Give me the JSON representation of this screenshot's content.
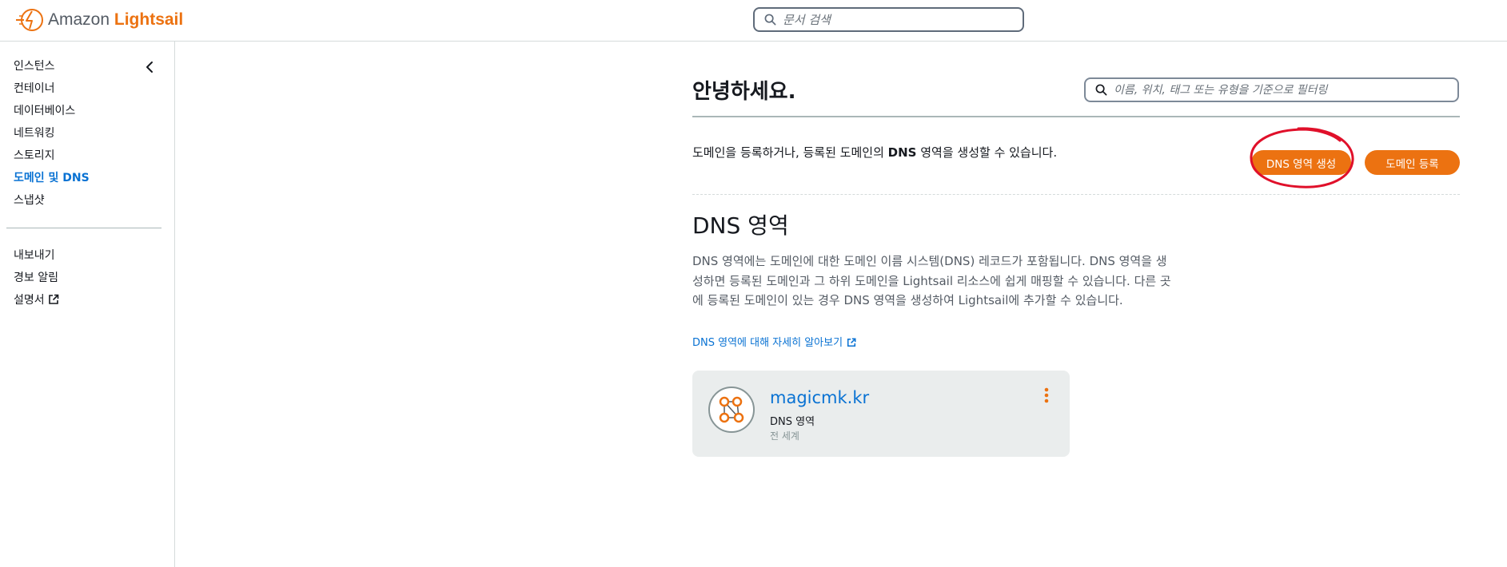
{
  "app": {
    "brand_prefix": "Amazon",
    "brand_name": "Lightsail"
  },
  "header": {
    "search_placeholder": "문서 검색"
  },
  "sidebar": {
    "items": [
      {
        "label": "인스턴스"
      },
      {
        "label": "컨테이너"
      },
      {
        "label": "데이터베이스"
      },
      {
        "label": "네트워킹"
      },
      {
        "label": "스토리지"
      },
      {
        "label": "도메인 및 DNS",
        "active": true
      },
      {
        "label": "스냅샷"
      }
    ],
    "secondary_items": [
      {
        "label": "내보내기"
      },
      {
        "label": "경보 알림"
      },
      {
        "label": "설명서",
        "icon": "external-link-icon"
      }
    ]
  },
  "main": {
    "greeting": "안녕하세요.",
    "filter_placeholder": "이름, 위치, 태그 또는 유형을 기준으로 필터링",
    "intro_part1": "도메인을 등록하거나, 등록된 도메인의 ",
    "intro_bold": "DNS",
    "intro_part2": " 영역을 생성할 수 있습니다.",
    "create_dns_zone_label": "DNS 영역 생성",
    "register_domain_label": "도메인 등록",
    "section_title": "DNS 영역",
    "section_description": "DNS 영역에는 도메인에 대한 도메인 이름 시스템(DNS) 레코드가 포함됩니다. DNS 영역을 생성하면 등록된 도메인과 그 하위 도메인을 Lightsail 리소스에 쉽게 매핑할 수 있습니다. 다른 곳에 등록된 도메인이 있는 경우 DNS 영역을 생성하여 Lightsail에 추가할 수 있습니다.",
    "learn_more_label": "DNS 영역에 대해 자세히 알아보기",
    "zones": [
      {
        "name": "magicmk.kr",
        "type": "DNS 영역",
        "region": "전 세계",
        "icon": "dns-zone-icon"
      }
    ]
  },
  "colors": {
    "accent": "#ec7211",
    "link": "#0972d3",
    "annotation": "#e0102a",
    "card_bg": "#eaeded"
  }
}
